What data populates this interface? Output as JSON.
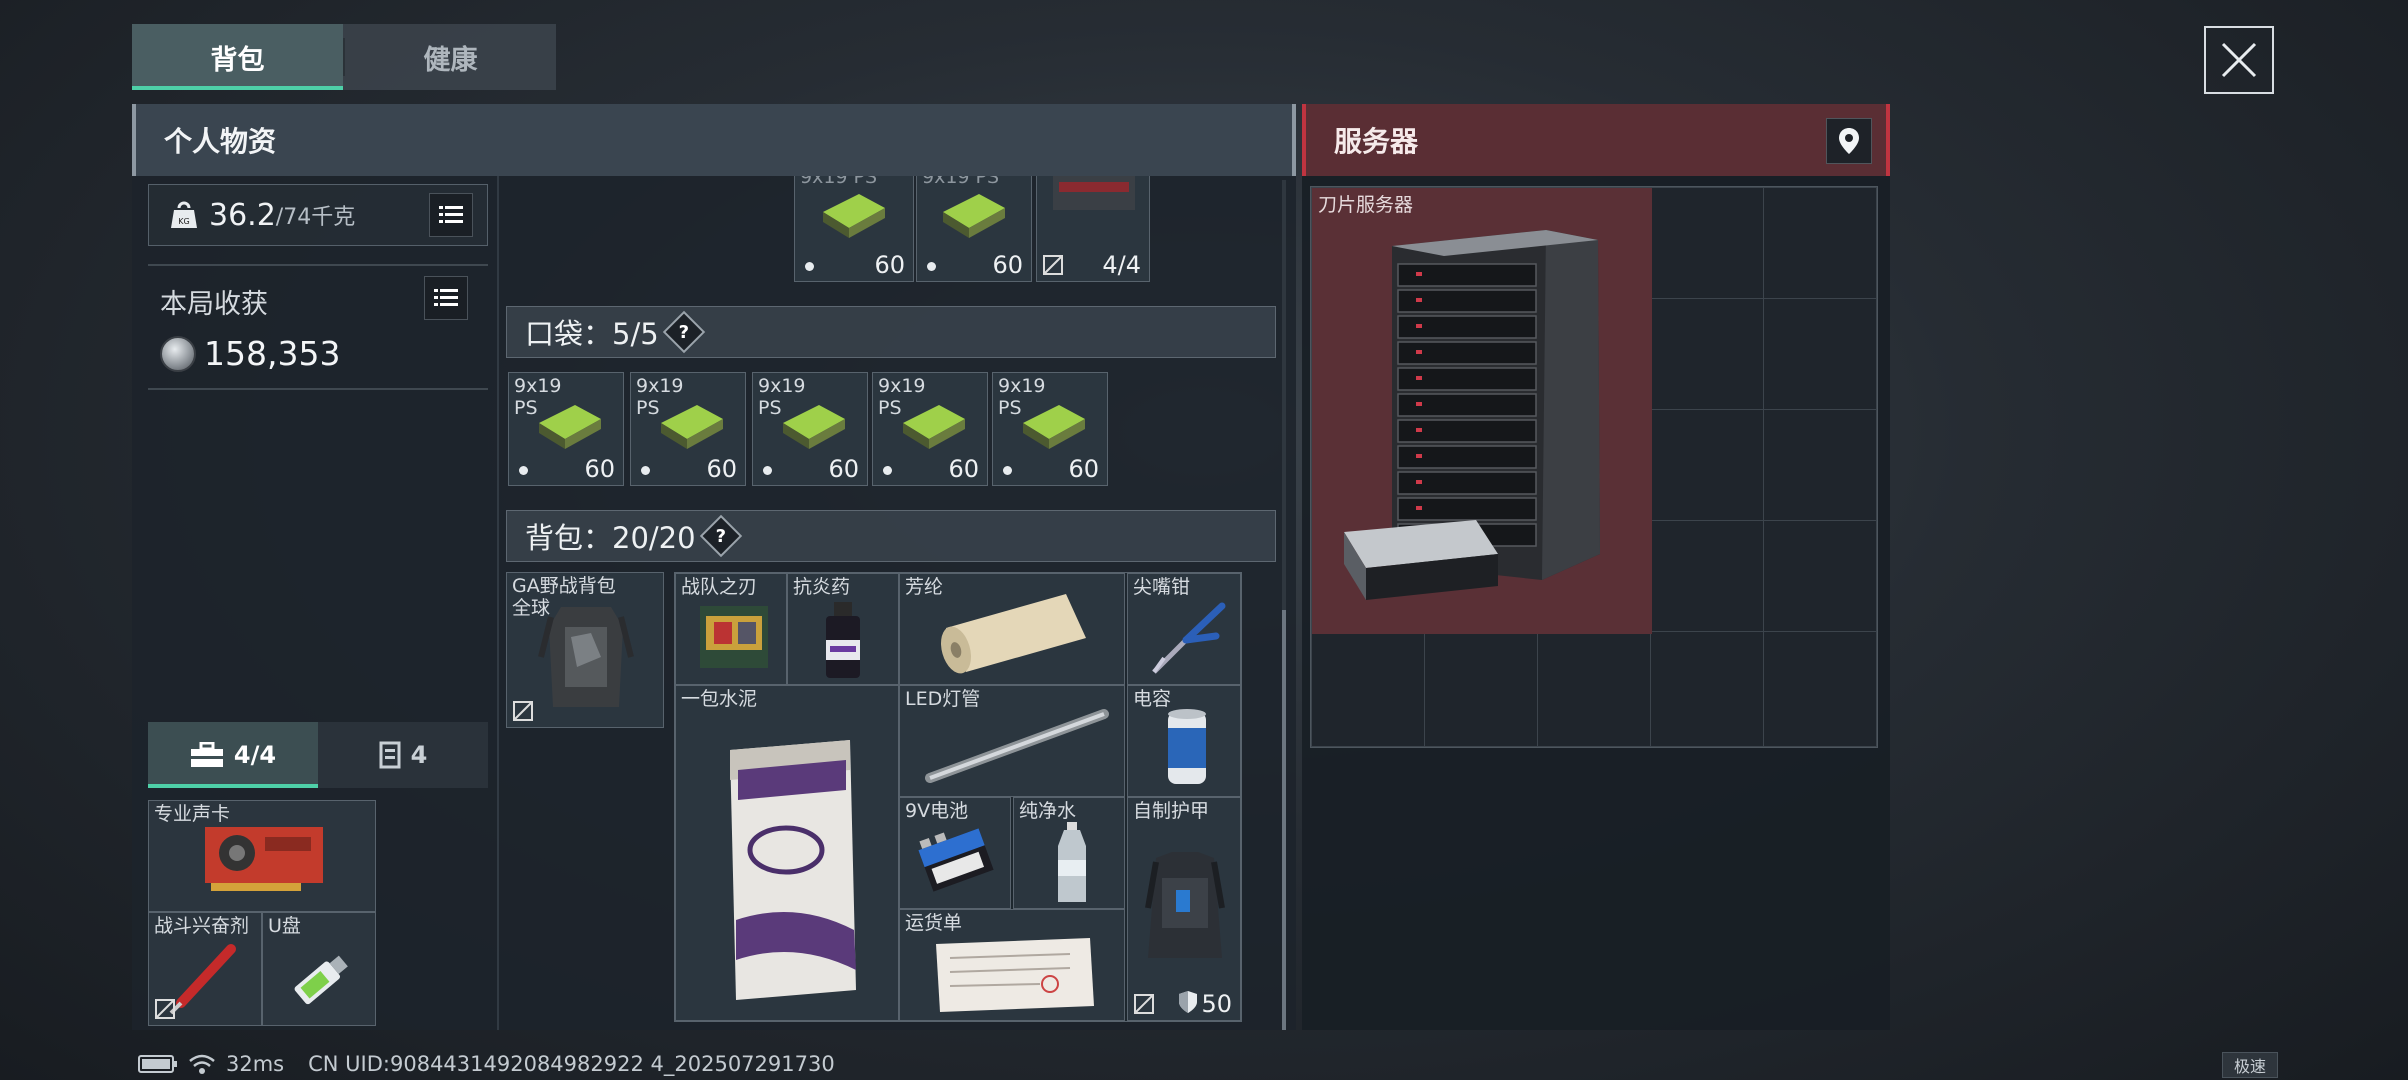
{
  "tabs": [
    {
      "label": "背包",
      "active": true
    },
    {
      "label": "健康",
      "active": false
    }
  ],
  "left_panel": {
    "title": "个人物资",
    "weight": {
      "current": "36.2",
      "max": "/74千克"
    },
    "earnings": {
      "label": "本局收获",
      "value": "158,353"
    },
    "sub_tabs": [
      {
        "label": "4/4",
        "icon": "toolbox-icon",
        "active": true
      },
      {
        "label": "4",
        "icon": "storage-icon",
        "active": false
      }
    ]
  },
  "secure_items": [
    {
      "name": "专业声卡",
      "icon": "sound-card-icon"
    },
    {
      "name": "战斗兴奋剂",
      "icon": "stimulant-icon"
    },
    {
      "name": "U盘",
      "icon": "usb-drive-icon"
    }
  ],
  "top_row": [
    {
      "label": "9x19\nPS",
      "count": "60"
    },
    {
      "label": "9x19\nPS",
      "count": "60"
    },
    {
      "label": "",
      "count": "4/4"
    }
  ],
  "pockets": {
    "label": "口袋：5/5",
    "items": [
      {
        "label": "9x19\nPS",
        "count": "60"
      },
      {
        "label": "9x19\nPS",
        "count": "60"
      },
      {
        "label": "9x19\nPS",
        "count": "60"
      },
      {
        "label": "9x19\nPS",
        "count": "60"
      },
      {
        "label": "9x19\nPS",
        "count": "60"
      }
    ]
  },
  "backpack": {
    "label": "背包：20/20",
    "bag_name": "GA野战背包\n全球",
    "items": [
      {
        "name": "战队之刃"
      },
      {
        "name": "抗炎药"
      },
      {
        "name": "芳纶"
      },
      {
        "name": "尖嘴钳"
      },
      {
        "name": "一包水泥"
      },
      {
        "name": "LED灯管"
      },
      {
        "name": "电容"
      },
      {
        "name": "9V电池"
      },
      {
        "name": "纯净水"
      },
      {
        "name": "自制护甲",
        "durability": "50"
      },
      {
        "name": "运货单"
      }
    ]
  },
  "right_panel": {
    "title": "服务器",
    "item": {
      "name": "刀片服务器"
    }
  },
  "status": {
    "ping": "32ms",
    "uid": "CN UID:9084431492084982922 4_202507291730",
    "speed_tag": "极速"
  },
  "colors": {
    "accent": "#4ed0a8",
    "server_red": "#c03440"
  }
}
